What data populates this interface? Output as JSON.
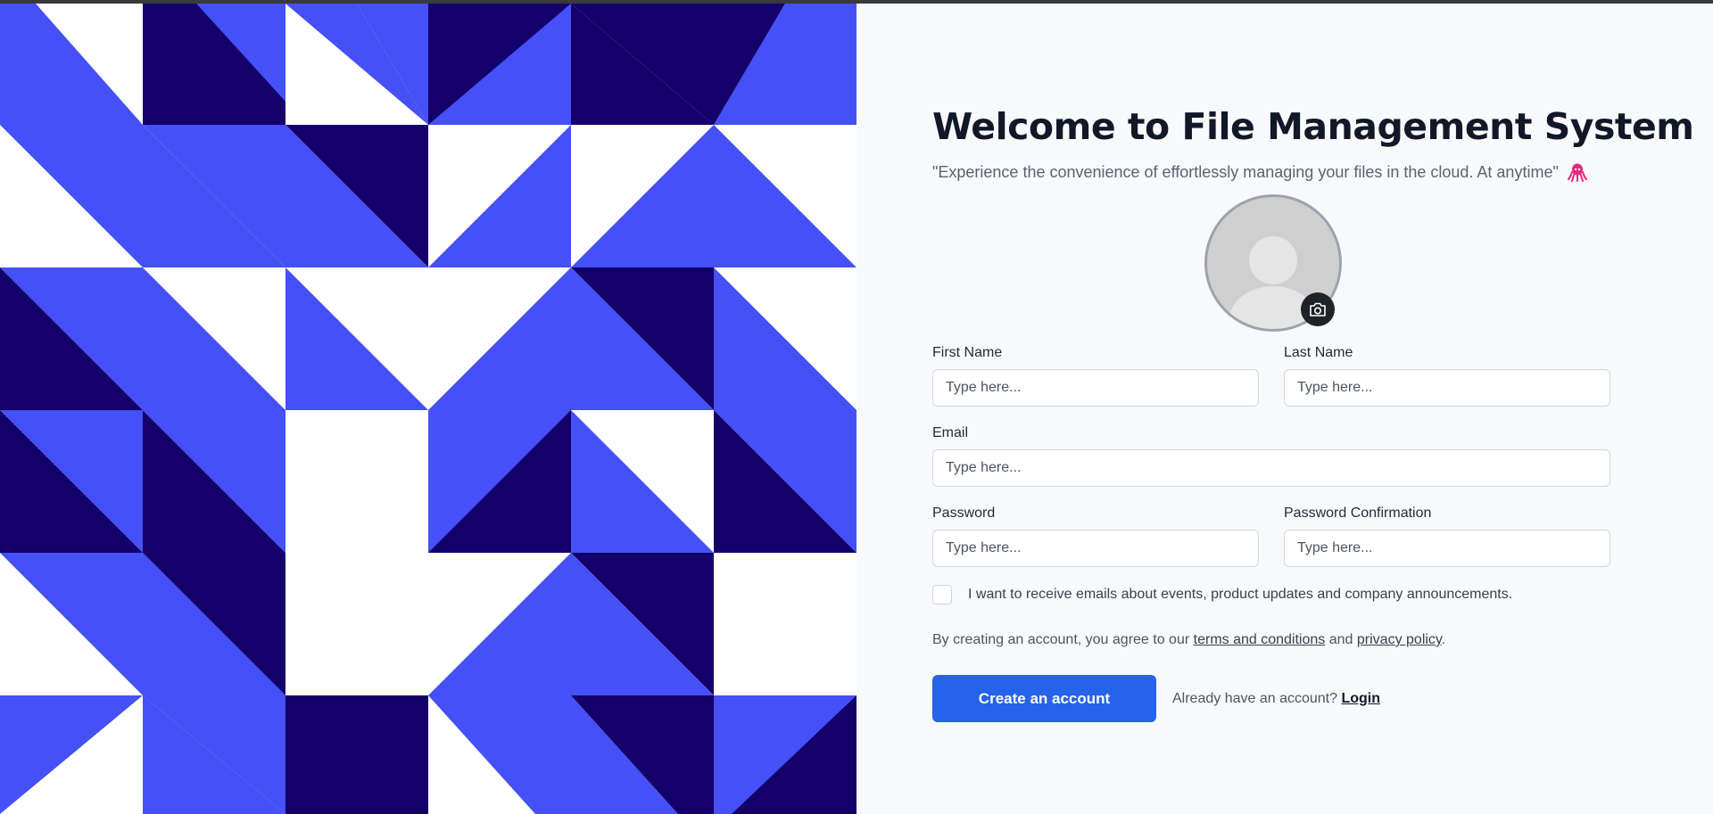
{
  "colors": {
    "pattern_blue": "#4550f7",
    "pattern_navy": "#14006b",
    "pattern_white": "#ffffff",
    "primary": "#2563eb",
    "octopus": "#e5277c"
  },
  "header": {
    "title": "Welcome to File Management System",
    "subtitle": "\"Experience the convenience of effortlessly managing your files in the cloud. At anytime\"",
    "subtitle_icon": "octopus-icon"
  },
  "avatar": {
    "upload_icon": "camera-icon"
  },
  "form": {
    "first_name": {
      "label": "First Name",
      "placeholder": "Type here..."
    },
    "last_name": {
      "label": "Last Name",
      "placeholder": "Type here..."
    },
    "email": {
      "label": "Email",
      "placeholder": "Type here..."
    },
    "password": {
      "label": "Password",
      "placeholder": "Type here..."
    },
    "password_confirmation": {
      "label": "Password Confirmation",
      "placeholder": "Type here..."
    },
    "newsletter_label": "I want to receive emails about events, product updates and company announcements.",
    "terms_prefix": "By creating an account, you agree to our",
    "terms_link": "terms and conditions",
    "terms_and": "and",
    "privacy_link": "privacy policy",
    "terms_suffix": ".",
    "submit_label": "Create an account",
    "login_prompt": "Already have an account?",
    "login_link": "Login"
  }
}
